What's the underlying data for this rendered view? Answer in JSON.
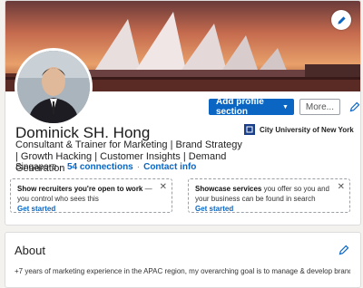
{
  "profile": {
    "name": "Dominick SH. Hong",
    "headline": "Consultant & Trainer for Marketing | Brand Strategy | Growth Hacking | Customer Insights | Demand Generation",
    "location": "Singapore",
    "connections": "54 connections",
    "contact_info": "Contact info",
    "education": "City University of New York"
  },
  "actions": {
    "add_section": "Add profile section",
    "more": "More..."
  },
  "cards": [
    {
      "title": "Show recruiters you're open to work",
      "text": " — you control who sees this",
      "cta": "Get started"
    },
    {
      "title": "Showcase services",
      "text": " you offer so you and your business can be found in search",
      "cta": "Get started"
    }
  ],
  "about": {
    "title": "About",
    "text": "+7 years of marketing experience in the APAC region, my overarching goal is to manage & develop brands by"
  },
  "colors": {
    "accent": "#0a66c2",
    "page_bg": "#f3f2ef"
  },
  "icons": [
    "pencil-icon",
    "close-icon",
    "chevron-down-icon",
    "university-logo-icon"
  ]
}
